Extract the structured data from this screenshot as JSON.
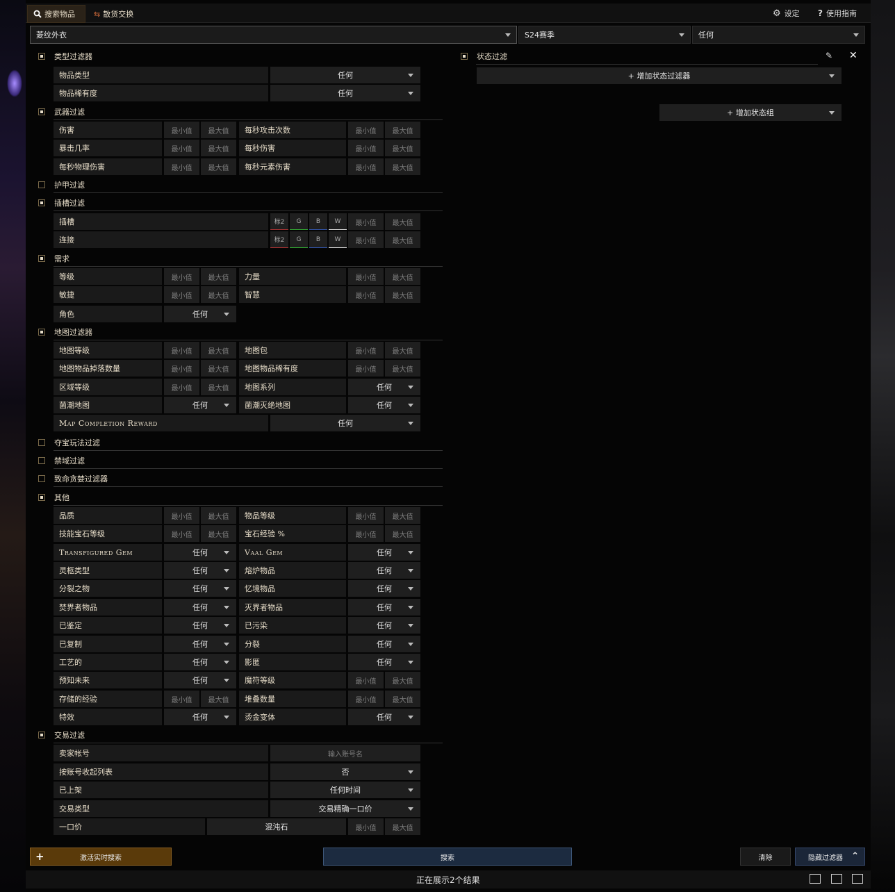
{
  "tabs": {
    "search": "搜索物品",
    "exchange": "散货交换"
  },
  "topright": {
    "settings": "设定",
    "guide": "使用指南"
  },
  "searchbar": {
    "item": "菱纹外衣",
    "league": "S24赛季",
    "status": "任何"
  },
  "placeholders": {
    "min": "最小值",
    "max": "最大值"
  },
  "sections": {
    "type": {
      "title": "类型过滤器",
      "item_type": "物品类型",
      "item_type_val": "任何",
      "rarity": "物品稀有度",
      "rarity_val": "任何"
    },
    "weapon": {
      "title": "武器过滤",
      "damage": "伤害",
      "aps": "每秒攻击次数",
      "crit": "暴击几率",
      "dps": "每秒伤害",
      "pdps": "每秒物理伤害",
      "edps": "每秒元素伤害"
    },
    "armour": {
      "title": "护甲过滤"
    },
    "socket": {
      "title": "插槽过滤",
      "sockets": "插槽",
      "links": "连接",
      "r": "标2",
      "g": "G",
      "b": "B",
      "w": "W"
    },
    "req": {
      "title": "需求",
      "level": "等级",
      "str": "力量",
      "dex": "敏捷",
      "int": "智慧",
      "class": "角色",
      "class_val": "任何"
    },
    "map": {
      "title": "地图过滤器",
      "tier": "地图等级",
      "packsize": "地图包",
      "iiq": "地图物品掉落数量",
      "iir": "地图物品稀有度",
      "area": "区域等级",
      "series": "地图系列",
      "series_val": "任何",
      "blighted": "菌潮地图",
      "blighted_val": "任何",
      "ravaged": "菌潮灭绝地图",
      "ravaged_val": "任何",
      "completion": "Map Completion Reward",
      "completion_val": "任何"
    },
    "heist": {
      "title": "夺宝玩法过滤"
    },
    "sanctum": {
      "title": "禁域过滤"
    },
    "ultimatum": {
      "title": "致命贪婪过滤器"
    },
    "misc": {
      "title": "其他",
      "quality": "品质",
      "ilvl": "物品等级",
      "gemlvl": "技能宝石等级",
      "gemexp": "宝石经验 %",
      "transfigured": "Transfigured Gem",
      "vaal": "Vaal Gem",
      "corpse": "灵柩类型",
      "crucible": "熔炉物品",
      "fractured": "分裂之物",
      "synth": "忆境物品",
      "searing": "焚界者物品",
      "eater": "灭界者物品",
      "identified": "已鉴定",
      "corrupted": "已污染",
      "mirrored": "已复制",
      "split": "分裂",
      "crafted": "工艺的",
      "veiled": "影匿",
      "foreseeing": "预知未来",
      "rune": "魔符等级",
      "stored": "存储的经验",
      "stack": "堆叠数量",
      "effect": "特效",
      "foil": "烫金变体",
      "any": "任何"
    },
    "trade": {
      "title": "交易过滤",
      "seller": "卖家帐号",
      "seller_ph": "输入账号名",
      "collapse": "按账号收起列表",
      "collapse_val": "否",
      "listed": "已上架",
      "listed_val": "任何时间",
      "saletype": "交易类型",
      "saletype_val": "交易精确一口价",
      "buyout": "一口价",
      "currency": "混沌石"
    }
  },
  "stat": {
    "title": "状态过滤",
    "add_filter": "+ 增加状态过滤器",
    "add_group": "+ 增加状态组"
  },
  "footer": {
    "live": "激活实时搜索",
    "search": "搜索",
    "clear": "清除",
    "hide": "隐藏过滤器",
    "results": "正在展示2个结果"
  },
  "colors": {
    "accent": "#5a3a0a",
    "search": "#1c2b40",
    "hide": "#1b2638"
  }
}
